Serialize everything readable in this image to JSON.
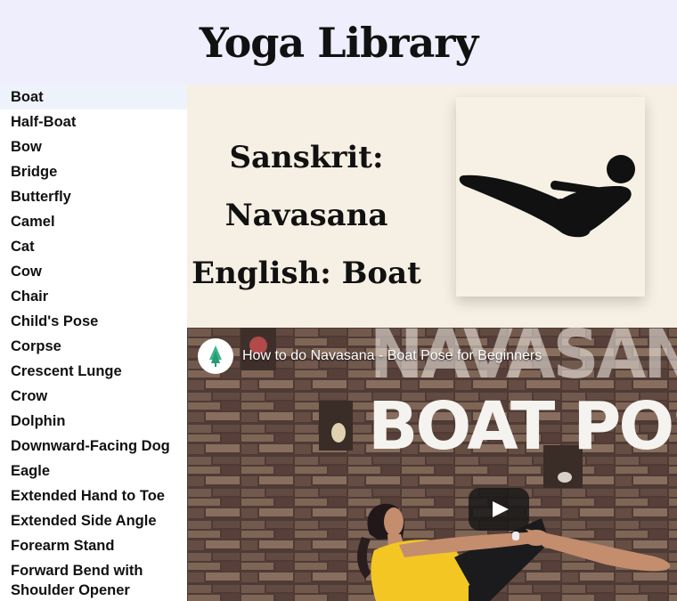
{
  "header": {
    "title": "Yoga Library"
  },
  "sidebar": {
    "selected": "Boat",
    "items": [
      "Boat",
      "Half-Boat",
      "Bow",
      "Bridge",
      "Butterfly",
      "Camel",
      "Cat",
      "Cow",
      "Chair",
      "Child's Pose",
      "Corpse",
      "Crescent Lunge",
      "Crow",
      "Dolphin",
      "Downward-Facing Dog",
      "Eagle",
      "Extended Hand to Toe",
      "Extended Side Angle",
      "Forearm Stand",
      "Forward Bend with Shoulder Opener"
    ]
  },
  "pose": {
    "sanskrit_label": "Sanskrit:",
    "sanskrit_name": "Navasana",
    "english": "English: Boat",
    "icon": "boat-pose-icon"
  },
  "video": {
    "title": "How to do Navasana - Boat Pose for Beginners",
    "overlay_line1": "NAVASANA",
    "overlay_line2": "BOAT POSE",
    "icon": "play-icon"
  },
  "colors": {
    "header_bg": "#eeeefd",
    "info_bg": "#f6efe3",
    "selected_item_bg": "#eef3fb",
    "outfit_top": "#f3c623"
  }
}
